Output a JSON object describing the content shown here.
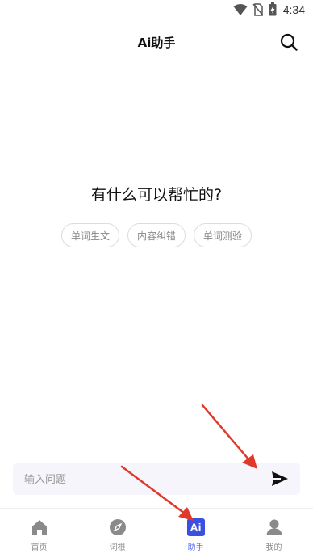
{
  "status_bar": {
    "time": "4:34"
  },
  "header": {
    "title": "Ai助手",
    "search_icon": "search-icon"
  },
  "prompt": {
    "title": "有什么可以帮忙的?",
    "chips": [
      "单词生文",
      "内容纠错",
      "单词测验"
    ]
  },
  "input": {
    "placeholder": "输入问题",
    "value": "",
    "send_icon": "send-icon"
  },
  "bottom_nav": {
    "items": [
      {
        "label": "首页",
        "icon": "home-icon",
        "active": false
      },
      {
        "label": "词根",
        "icon": "compass-icon",
        "active": false
      },
      {
        "label": "助手",
        "icon": "ai-assistant-icon",
        "active": true
      },
      {
        "label": "我的",
        "icon": "profile-icon",
        "active": false
      }
    ]
  },
  "colors": {
    "accent": "#3b4fe0",
    "active_label": "#5a6cf0",
    "annotation_arrow": "#e0392b",
    "input_bg": "#f5f5fb"
  }
}
